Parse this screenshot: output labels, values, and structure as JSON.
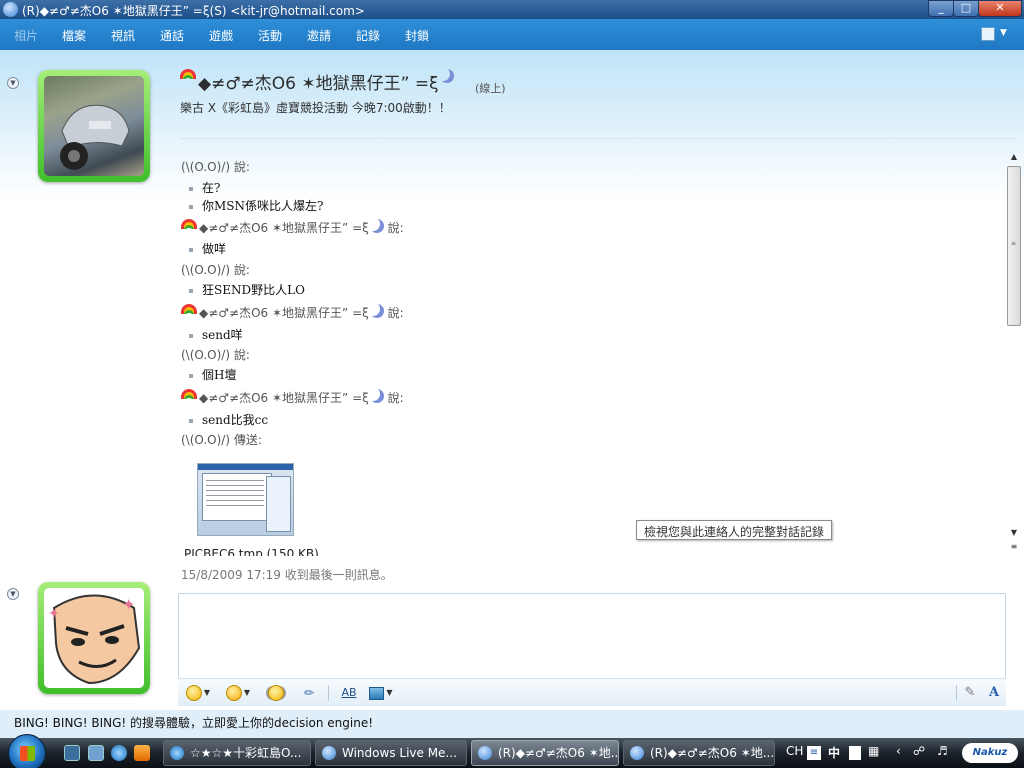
{
  "window": {
    "title": "(R)◆≠♂≠杰O6 ✶地獄黑仔王” =ξ(S) <kit-jr@hotmail.com>"
  },
  "menu": {
    "items": [
      "相片",
      "檔案",
      "視訊",
      "通話",
      "遊戲",
      "活動",
      "邀請",
      "記錄",
      "封鎖"
    ]
  },
  "contact": {
    "name": "◆≠♂≠杰O6 ✶地獄黑仔王” =ξ",
    "status": "(線上)",
    "personal_message": "樂古 X《彩虹島》虛寶競投活動 今晚7:00啟動！！"
  },
  "conversation": {
    "friend_said": "(\\(O.O)/) 說:",
    "contact_said": "◆≠♂≠杰O6 ✶地獄黑仔王” =ξ",
    "said_suffix": "說:",
    "messages": [
      "在?",
      "你MSN係咪比人爆左?",
      "做咩",
      "狂SEND野比人LO",
      "send咩",
      "個H壇",
      "send比我cc"
    ],
    "friend_sent": "(\\(O.O)/) 傳送:",
    "file_name": "PICBEC6.tmp (150 KB)",
    "timestamp": "15/8/2009 17:19 收到最後一則訊息。"
  },
  "tooltip": "檢視您與此連絡人的完整對話記錄",
  "input": {
    "value": "",
    "placeholder": ""
  },
  "toolbar": {
    "font_label": "A"
  },
  "ad": {
    "text": "BING! BING! BING! 的搜尋體驗，立即愛上你的decision engine!"
  },
  "taskbar": {
    "tasks": [
      "☆★☆★十彩虹島O...",
      "Windows Live Me...",
      "(R)◆≠♂≠杰O6 ✶地...",
      "(R)◆≠♂≠杰O6 ✶地..."
    ],
    "lang": "CH",
    "ime": "中",
    "brand": "Nakuz"
  },
  "colors": {
    "menu_bar": "#1f78c4",
    "title_bar": "#1c4f8a",
    "dp_frame": "#3fbf2a"
  }
}
